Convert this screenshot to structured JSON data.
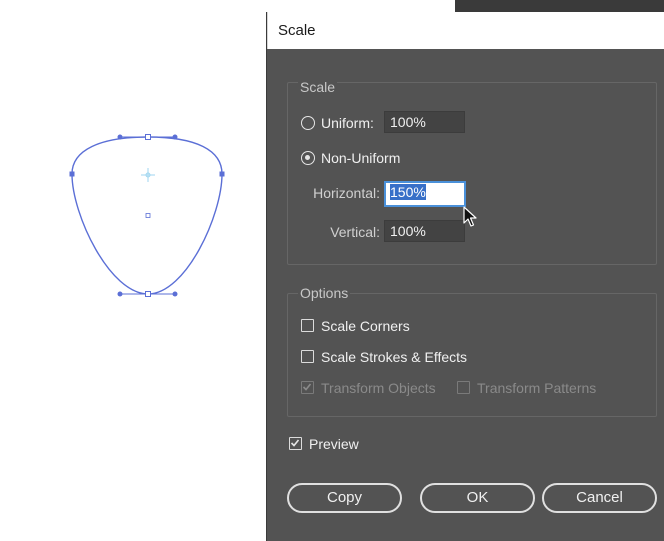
{
  "dialog": {
    "title": "Scale",
    "scale_group": {
      "label": "Scale",
      "uniform_label": "Uniform:",
      "uniform_value": "100%",
      "uniform_selected": false,
      "non_uniform_label": "Non-Uniform",
      "non_uniform_selected": true,
      "horizontal_label": "Horizontal:",
      "horizontal_value": "150%",
      "vertical_label": "Vertical:",
      "vertical_value": "100%"
    },
    "options_group": {
      "label": "Options",
      "scale_corners_label": "Scale Corners",
      "scale_corners_checked": false,
      "scale_strokes_label": "Scale Strokes & Effects",
      "scale_strokes_checked": false,
      "transform_objects_label": "Transform Objects",
      "transform_objects_checked": true,
      "transform_patterns_label": "Transform Patterns",
      "transform_patterns_checked": false
    },
    "preview_label": "Preview",
    "preview_checked": true,
    "buttons": {
      "copy": "Copy",
      "ok": "OK",
      "cancel": "Cancel"
    }
  },
  "colors": {
    "dialog_bg": "#535353",
    "selection_stroke": "#5b6fd6",
    "focus_border": "#4a90d9"
  }
}
